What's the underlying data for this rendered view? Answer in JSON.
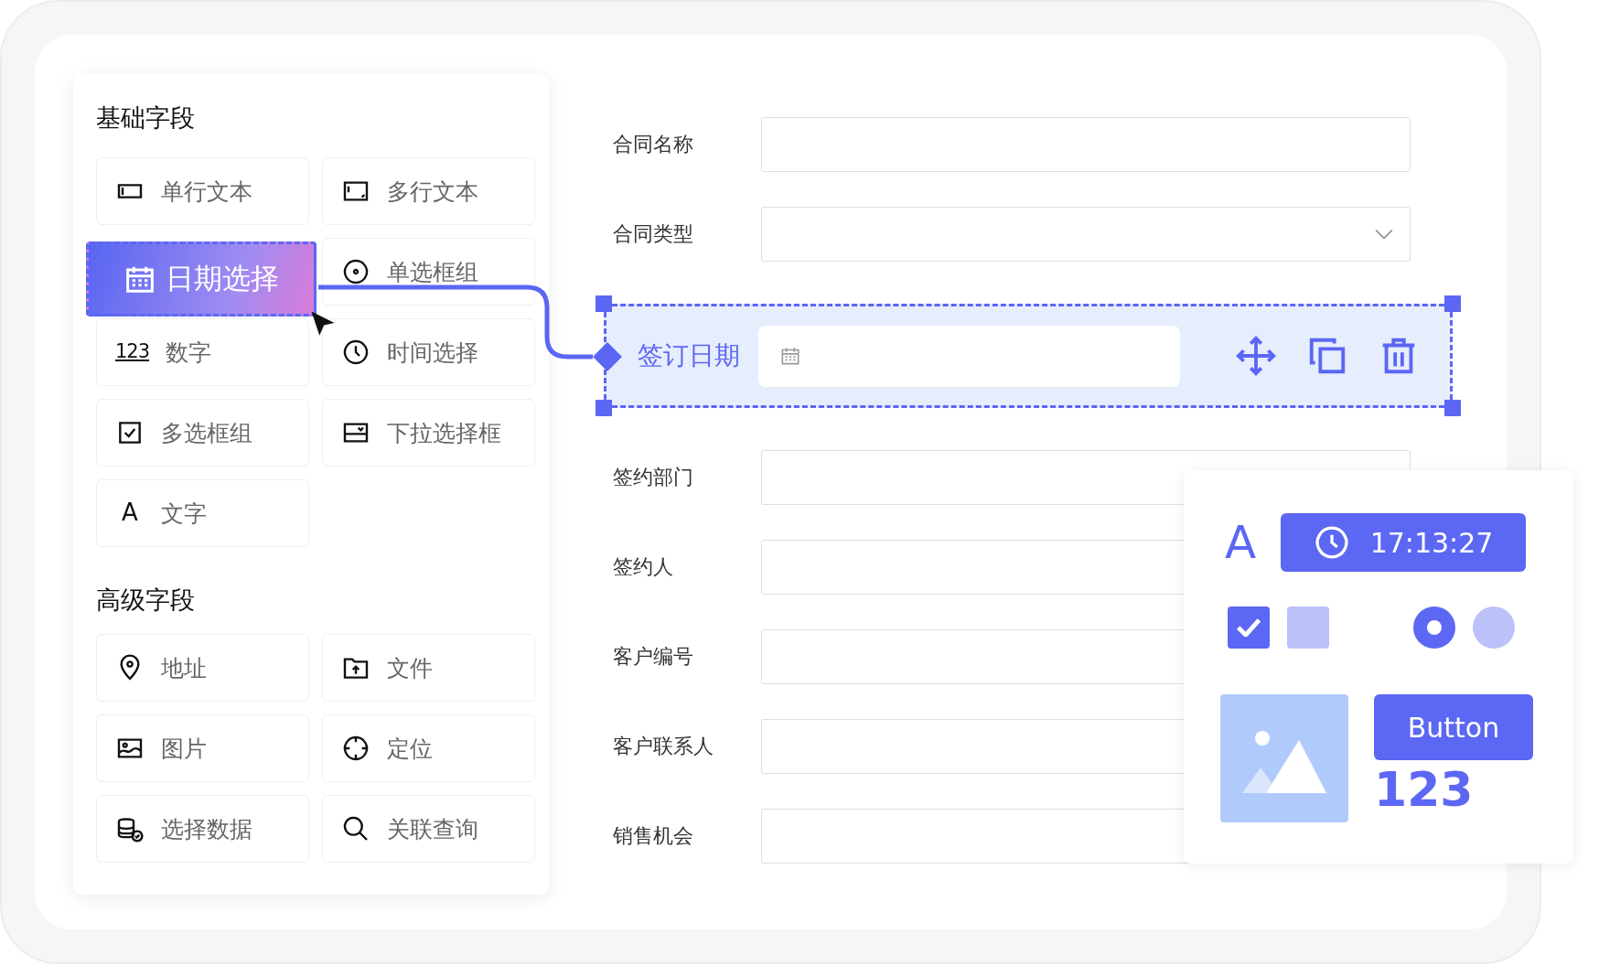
{
  "palette": {
    "sections": [
      {
        "title": "基础字段",
        "items": [
          {
            "label": "单行文本",
            "kind": "normal"
          },
          {
            "label": "多行文本",
            "kind": "normal"
          },
          {
            "label": "日期选择",
            "kind": "dragging"
          },
          {
            "label": "单选框组",
            "kind": "normal"
          },
          {
            "label": "数字",
            "kind": "normal",
            "glyph": "123"
          },
          {
            "label": "时间选择",
            "kind": "normal"
          },
          {
            "label": "多选框组",
            "kind": "normal"
          },
          {
            "label": "下拉选择框",
            "kind": "normal"
          },
          {
            "label": "文字",
            "kind": "normal",
            "glyph": "A"
          }
        ]
      },
      {
        "title": "高级字段",
        "items": [
          {
            "label": "地址",
            "kind": "normal"
          },
          {
            "label": "文件",
            "kind": "normal"
          },
          {
            "label": "图片",
            "kind": "normal"
          },
          {
            "label": "定位",
            "kind": "normal"
          },
          {
            "label": "选择数据",
            "kind": "normal"
          },
          {
            "label": "关联查询",
            "kind": "normal"
          }
        ]
      }
    ]
  },
  "form": {
    "fields": [
      {
        "label": "合同名称",
        "kind": "text",
        "selected": false
      },
      {
        "label": "合同类型",
        "kind": "select",
        "selected": false
      },
      {
        "label": "签订日期",
        "kind": "date",
        "selected": true
      },
      {
        "label": "签约部门",
        "kind": "text",
        "selected": false
      },
      {
        "label": "签约人",
        "kind": "text",
        "selected": false
      },
      {
        "label": "客户编号",
        "kind": "text",
        "selected": false
      },
      {
        "label": "客户联系人",
        "kind": "text",
        "selected": false
      },
      {
        "label": "销售机会",
        "kind": "text",
        "selected": false
      }
    ]
  },
  "widgets": {
    "glyph": "A",
    "time": "17:13:27",
    "checkboxes": [
      {
        "checked": true
      },
      {
        "checked": false
      }
    ],
    "radios": [
      {
        "selected": true
      },
      {
        "selected": false
      }
    ],
    "button": "Button",
    "number": "123"
  }
}
